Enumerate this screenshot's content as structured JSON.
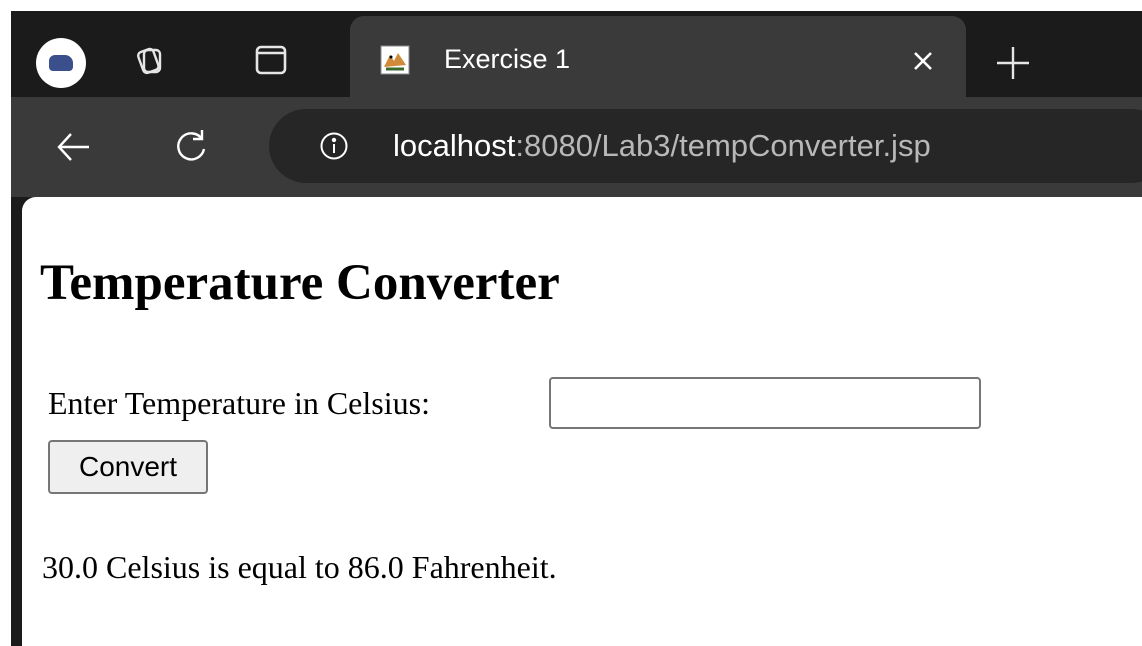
{
  "browser": {
    "tab": {
      "title": "Exercise 1"
    },
    "address_bar": {
      "host": "localhost",
      "path": ":8080/Lab3/tempConverter.jsp"
    },
    "icons": {
      "profile": "profile-avatar-icon",
      "workspaces": "workspaces-icon",
      "vertical_tabs": "tab-actions-icon",
      "favicon": "tomcat-favicon-icon",
      "close": "close-icon",
      "new_tab": "plus-icon",
      "back": "back-arrow-icon",
      "refresh": "refresh-icon",
      "info": "info-icon"
    }
  },
  "page": {
    "title": "Temperature Converter",
    "input_label": "Enter Temperature in Celsius:",
    "input_value": "",
    "input_placeholder": "",
    "button_label": "Convert",
    "result_text": "30.0 Celsius is equal to 86.0 Fahrenheit."
  },
  "colors": {
    "tabstrip_bg": "#1b1b1b",
    "active_tab_bg": "#3a3a3a",
    "addressbar_bg": "#262626",
    "page_bg": "#ffffff"
  }
}
